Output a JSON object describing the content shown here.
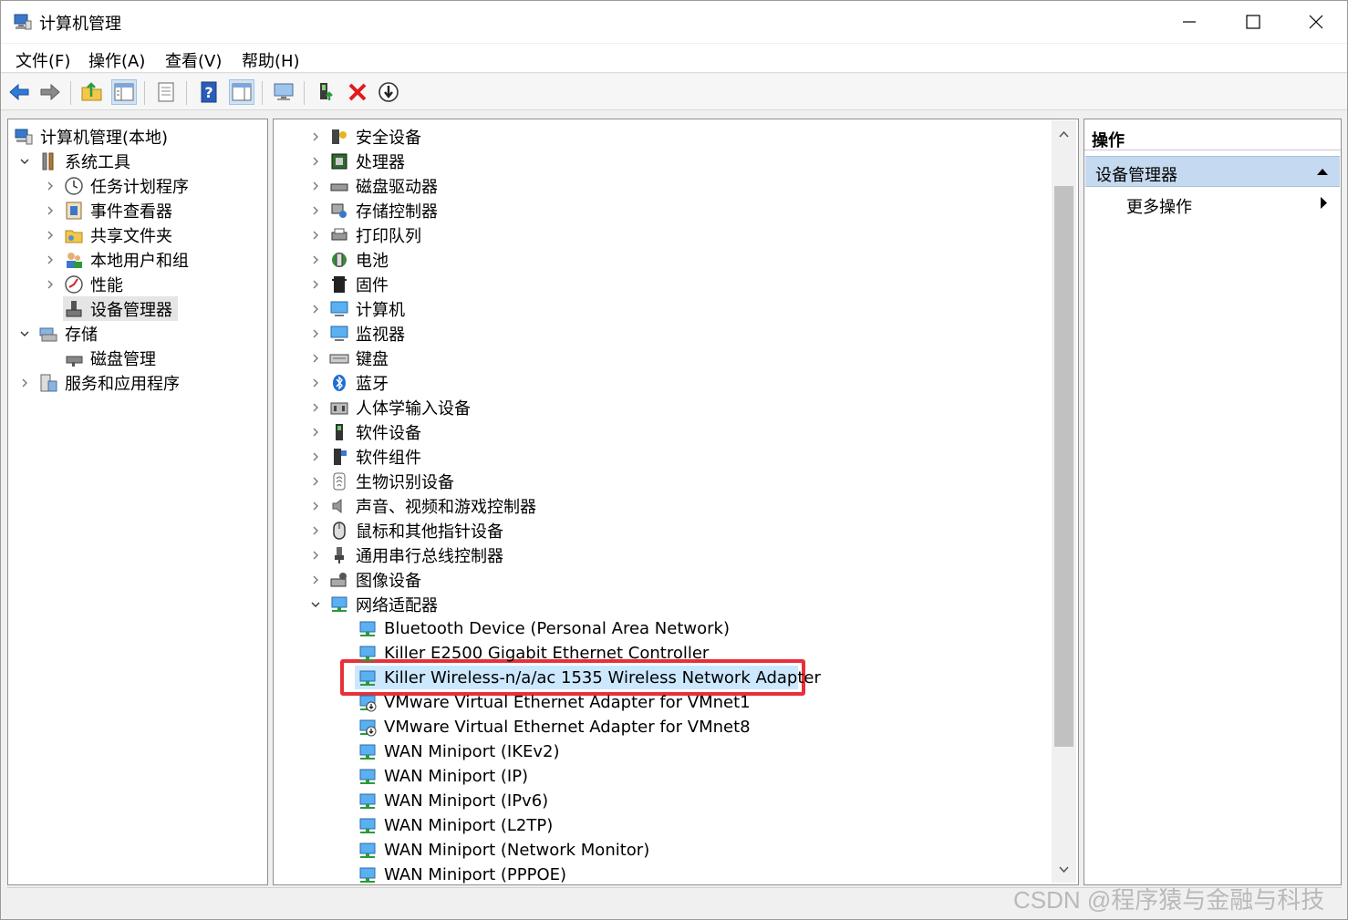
{
  "window": {
    "title": "计算机管理"
  },
  "menu": [
    "文件(F)",
    "操作(A)",
    "查看(V)",
    "帮助(H)"
  ],
  "toolbar": {
    "icons": [
      "back-icon",
      "forward-icon",
      "up-folder-icon",
      "show-hide-tree-icon",
      "export-list-icon",
      "help-icon",
      "action-pane-icon",
      "computer-monitor-icon",
      "update-driver-icon",
      "uninstall-icon",
      "scan-hardware-icon"
    ]
  },
  "left_tree": {
    "root": "计算机管理(本地)",
    "system_tools": "系统工具",
    "task_scheduler": "任务计划程序",
    "event_viewer": "事件查看器",
    "shared_folders": "共享文件夹",
    "local_users": "本地用户和组",
    "performance": "性能",
    "device_manager": "设备管理器",
    "storage": "存储",
    "disk_management": "磁盘管理",
    "services_apps": "服务和应用程序"
  },
  "device_categories": [
    "安全设备",
    "处理器",
    "磁盘驱动器",
    "存储控制器",
    "打印队列",
    "电池",
    "固件",
    "计算机",
    "监视器",
    "键盘",
    "蓝牙",
    "人体学输入设备",
    "软件设备",
    "软件组件",
    "生物识别设备",
    "声音、视频和游戏控制器",
    "鼠标和其他指针设备",
    "通用串行总线控制器",
    "图像设备",
    "网络适配器"
  ],
  "network_adapters": [
    "Bluetooth Device (Personal Area Network)",
    "Killer E2500 Gigabit Ethernet Controller",
    "Killer Wireless-n/a/ac 1535 Wireless Network Adapter",
    "VMware Virtual Ethernet Adapter for VMnet1",
    "VMware Virtual Ethernet Adapter for VMnet8",
    "WAN Miniport (IKEv2)",
    "WAN Miniport (IP)",
    "WAN Miniport (IPv6)",
    "WAN Miniport (L2TP)",
    "WAN Miniport (Network Monitor)",
    "WAN Miniport (PPPOE)"
  ],
  "actions": {
    "header": "操作",
    "section": "设备管理器",
    "more": "更多操作"
  },
  "watermark": "CSDN @程序猿与金融与科技",
  "colors": {
    "highlight_box": "#e8303a",
    "selection": "#cce8ff",
    "action_section": "#c5daf0"
  }
}
